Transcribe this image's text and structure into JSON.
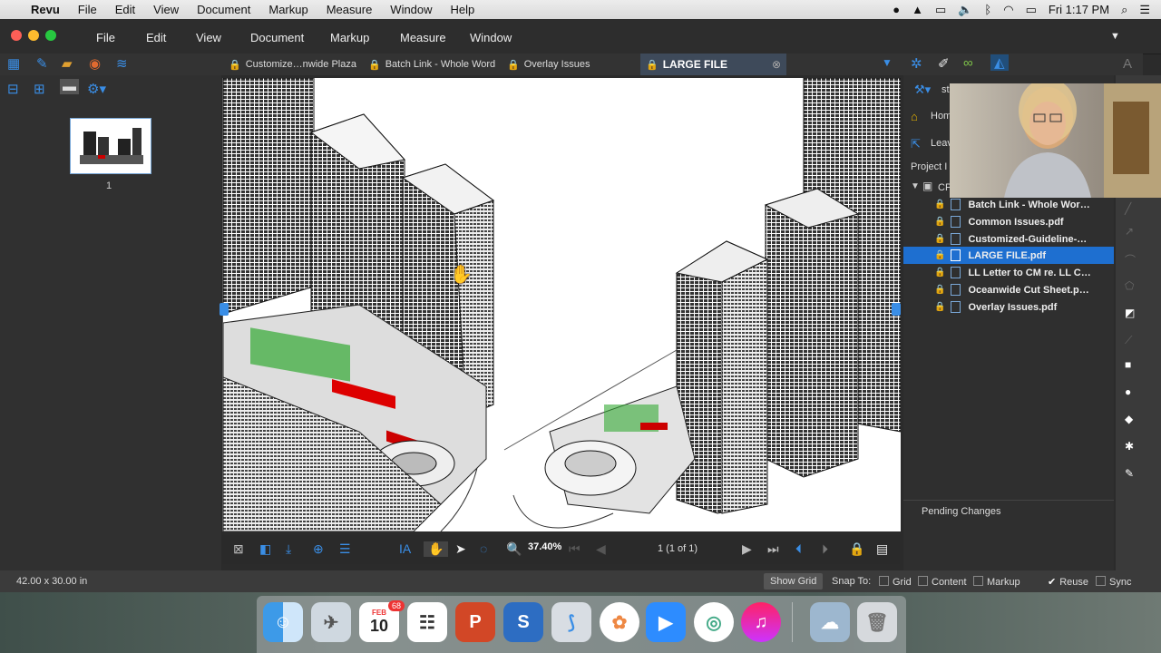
{
  "mac_menu": {
    "app": "Revu",
    "items": [
      "File",
      "Edit",
      "View",
      "Document",
      "Markup",
      "Measure",
      "Window",
      "Help"
    ],
    "clock": "Fri 1:17 PM"
  },
  "app_menu": {
    "items": [
      "File",
      "Edit",
      "View",
      "Document",
      "Markup",
      "Measure",
      "Window"
    ]
  },
  "tabs": [
    {
      "label": "Customize…nwide Plaza",
      "active": false
    },
    {
      "label": "Batch Link - Whole Word",
      "active": false
    },
    {
      "label": "Overlay Issues",
      "active": false
    },
    {
      "label": "LARGE FILE",
      "active": true
    }
  ],
  "thumbnail": {
    "page_label": "1"
  },
  "bottom": {
    "zoom": "37.40%",
    "page_indicator": "1 (1 of 1)"
  },
  "right_panel": {
    "partial_labels": [
      "st",
      "Hom",
      "Leav",
      "Project I",
      "CP"
    ],
    "files": [
      {
        "name": "Batch Link - Whole Wor…",
        "selected": false
      },
      {
        "name": "Common Issues.pdf",
        "selected": false
      },
      {
        "name": "Customized-Guideline-…",
        "selected": false
      },
      {
        "name": "LARGE FILE.pdf",
        "selected": true
      },
      {
        "name": "LL Letter to CM re. LL C…",
        "selected": false
      },
      {
        "name": "Oceanwide Cut Sheet.p…",
        "selected": false
      },
      {
        "name": "Overlay Issues.pdf",
        "selected": false
      }
    ],
    "pending": "Pending Changes"
  },
  "status": {
    "dimensions": "42.00 x 30.00 in",
    "show_grid": "Show Grid",
    "snap_to": "Snap To:",
    "grid": "Grid",
    "content": "Content",
    "markup": "Markup",
    "reuse": "Reuse",
    "sync": "Sync"
  },
  "dock": {
    "calendar_month": "FEB",
    "calendar_day": "10",
    "badge": "68"
  },
  "colors": {
    "selection": "#1e6fd0",
    "lock": "#e8b500",
    "accent_blue": "#3a8ee6"
  }
}
